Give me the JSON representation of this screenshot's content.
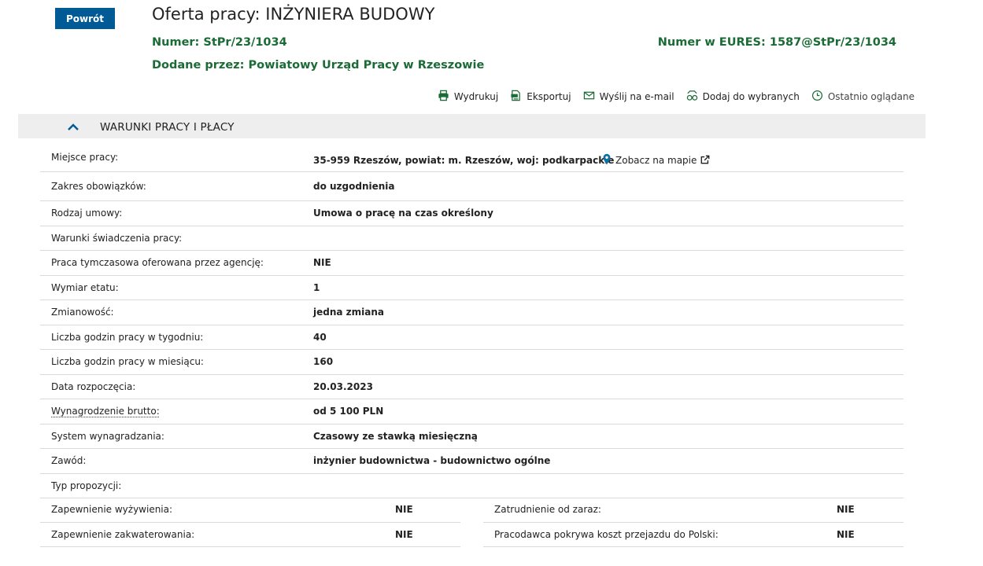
{
  "back_button": "Powrót",
  "title": "Oferta pracy: INŻYNIERA BUDOWY",
  "number_label": "Numer:",
  "number_value": "StPr/23/1034",
  "eures_label": "Numer w EURES:",
  "eures_value": "1587@StPr/23/1034",
  "added_label": "Dodane przez:",
  "added_value": "Powiatowy Urząd Pracy w Rzeszowie",
  "actions": {
    "print": "Wydrukuj",
    "export": "Eksportuj",
    "email": "Wyślij na e-mail",
    "favorite": "Dodaj do wybranych",
    "recent": "Ostatnio oglądane"
  },
  "section_title": "WARUNKI PRACY I PŁACY",
  "map_link": "Zobacz na mapie",
  "rows": [
    {
      "label": "Miejsce pracy:",
      "value": "35-959 Rzeszów, powiat: m. Rzeszów, woj: podkarpackie"
    },
    {
      "label": "Zakres obowiązków:",
      "value": "do uzgodnienia"
    },
    {
      "label": "Rodzaj umowy:",
      "value": "Umowa o pracę na czas określony"
    },
    {
      "label": "Warunki świadczenia pracy:",
      "value": ""
    },
    {
      "label": "Praca tymczasowa oferowana przez agencję:",
      "value": "NIE"
    },
    {
      "label": "Wymiar etatu:",
      "value": "1"
    },
    {
      "label": "Zmianowość:",
      "value": "jedna zmiana"
    },
    {
      "label": "Liczba godzin pracy w tygodniu:",
      "value": "40"
    },
    {
      "label": "Liczba godzin pracy w miesiącu:",
      "value": "160"
    },
    {
      "label": "Data rozpoczęcia:",
      "value": "20.03.2023"
    },
    {
      "label": "Wynagrodzenie brutto:",
      "value": "od 5 100 PLN"
    },
    {
      "label": "System wynagradzania:",
      "value": "Czasowy ze stawką miesięczną"
    },
    {
      "label": "Zawód:",
      "value": "inżynier budownictwa - budownictwo ogólne"
    },
    {
      "label": "Typ propozycji:",
      "value": ""
    }
  ],
  "half_rows": [
    {
      "left_label": "Zapewnienie wyżywienia:",
      "left_value": "NIE",
      "right_label": "Zatrudnienie od zaraz:",
      "right_value": "NIE"
    },
    {
      "left_label": "Zapewnienie zakwaterowania:",
      "left_value": "NIE",
      "right_label": "Pracodawca pokrywa koszt przejazdu do Polski:",
      "right_value": "NIE"
    }
  ],
  "colors": {
    "primary_button": "#005a96",
    "green_text": "#1a6b35",
    "section_bg": "#eeeeee",
    "icon_green": "#1a6b35",
    "map_pin": "#0b6fa4"
  }
}
